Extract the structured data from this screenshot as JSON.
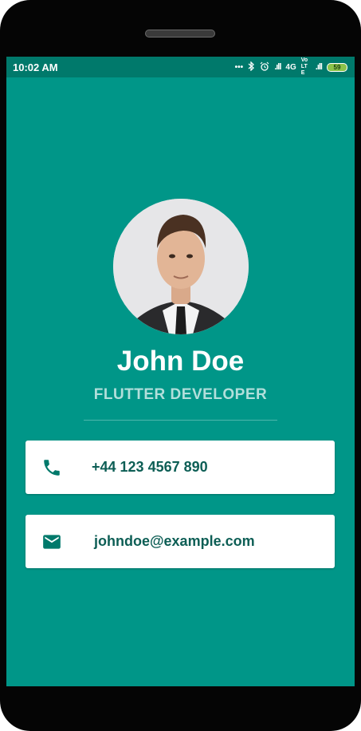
{
  "status_bar": {
    "time": "10:02 AM",
    "icons": [
      "more-dots-icon",
      "bluetooth-icon",
      "alarm-icon",
      "signal-icon",
      "network-4g-icon",
      "volte-icon",
      "signal-icon",
      "battery-icon"
    ],
    "network": "4G",
    "volte": "VoLTE",
    "battery": "59"
  },
  "profile": {
    "name": "John Doe",
    "title": "FLUTTER DEVELOPER"
  },
  "contacts": {
    "phone": "+44 123 4567 890",
    "email": "johndoe@example.com"
  },
  "colors": {
    "background": "#009688",
    "status_bar": "#00796b",
    "card": "#ffffff",
    "card_text": "#0d5e55",
    "subtitle": "#b2dfdb"
  }
}
